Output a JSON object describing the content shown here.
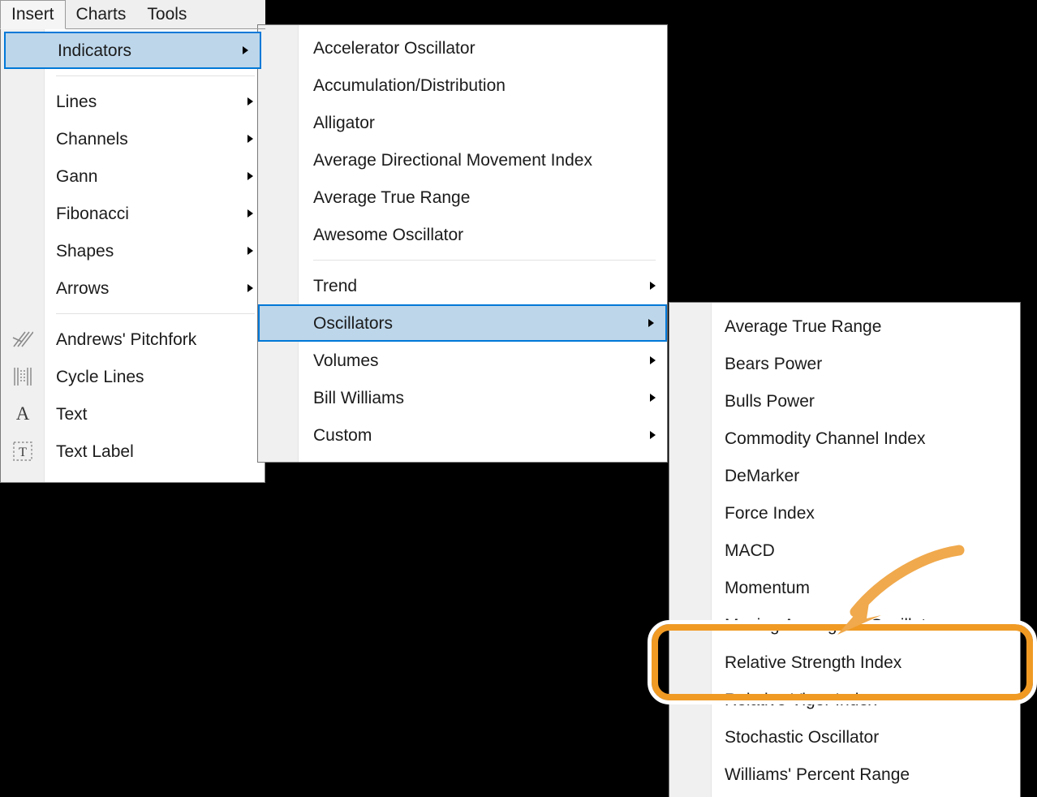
{
  "app": {
    "background_color": "#000000",
    "accent_selection_color": "#0078d7",
    "selection_fill_color": "#bdd6ea",
    "annotation_color": "#f09a24",
    "arrow_color": "#f0a94c"
  },
  "menubar": {
    "tabs": [
      {
        "label": "Insert",
        "active": true
      },
      {
        "label": "Charts",
        "active": false
      },
      {
        "label": "Tools",
        "active": false
      }
    ]
  },
  "menu_insert": {
    "name": "Insert menu",
    "groups": [
      {
        "items": [
          {
            "label": "Indicators",
            "has_submenu": true,
            "selected": true,
            "icon": null
          }
        ]
      },
      {
        "items": [
          {
            "label": "Lines",
            "has_submenu": true,
            "selected": false,
            "icon": null
          },
          {
            "label": "Channels",
            "has_submenu": true,
            "selected": false,
            "icon": null
          },
          {
            "label": "Gann",
            "has_submenu": true,
            "selected": false,
            "icon": null
          },
          {
            "label": "Fibonacci",
            "has_submenu": true,
            "selected": false,
            "icon": null
          },
          {
            "label": "Shapes",
            "has_submenu": true,
            "selected": false,
            "icon": null
          },
          {
            "label": "Arrows",
            "has_submenu": true,
            "selected": false,
            "icon": null
          }
        ]
      },
      {
        "items": [
          {
            "label": "Andrews' Pitchfork",
            "has_submenu": false,
            "selected": false,
            "icon": "pitchfork-icon"
          },
          {
            "label": "Cycle Lines",
            "has_submenu": false,
            "selected": false,
            "icon": "cycle-lines-icon"
          },
          {
            "label": "Text",
            "has_submenu": false,
            "selected": false,
            "icon": "text-a-icon"
          },
          {
            "label": "Text Label",
            "has_submenu": false,
            "selected": false,
            "icon": "text-label-icon"
          }
        ]
      }
    ]
  },
  "menu_indicators": {
    "name": "Indicators submenu",
    "groups": [
      {
        "items": [
          {
            "label": "Accelerator Oscillator",
            "has_submenu": false,
            "selected": false
          },
          {
            "label": "Accumulation/Distribution",
            "has_submenu": false,
            "selected": false
          },
          {
            "label": "Alligator",
            "has_submenu": false,
            "selected": false
          },
          {
            "label": "Average Directional Movement Index",
            "has_submenu": false,
            "selected": false
          },
          {
            "label": "Average True Range",
            "has_submenu": false,
            "selected": false
          },
          {
            "label": "Awesome Oscillator",
            "has_submenu": false,
            "selected": false
          }
        ]
      },
      {
        "items": [
          {
            "label": "Trend",
            "has_submenu": true,
            "selected": false
          },
          {
            "label": "Oscillators",
            "has_submenu": true,
            "selected": true
          },
          {
            "label": "Volumes",
            "has_submenu": true,
            "selected": false
          },
          {
            "label": "Bill Williams",
            "has_submenu": true,
            "selected": false
          },
          {
            "label": "Custom",
            "has_submenu": true,
            "selected": false
          }
        ]
      }
    ]
  },
  "menu_oscillators": {
    "name": "Oscillators submenu",
    "items": [
      {
        "label": "Average True Range",
        "highlighted": false
      },
      {
        "label": "Bears Power",
        "highlighted": false
      },
      {
        "label": "Bulls Power",
        "highlighted": false
      },
      {
        "label": "Commodity Channel Index",
        "highlighted": false
      },
      {
        "label": "DeMarker",
        "highlighted": false
      },
      {
        "label": "Force Index",
        "highlighted": false
      },
      {
        "label": "MACD",
        "highlighted": false
      },
      {
        "label": "Momentum",
        "highlighted": false
      },
      {
        "label": "Moving Average of Oscillator",
        "highlighted": false
      },
      {
        "label": "Relative Strength Index",
        "highlighted": true
      },
      {
        "label": "Relative Vigor Index",
        "highlighted": false
      },
      {
        "label": "Stochastic Oscillator",
        "highlighted": false
      },
      {
        "label": "Williams' Percent Range",
        "highlighted": false
      }
    ]
  },
  "annotations": {
    "highlight_target": "Relative Strength Index",
    "arrow": "curved-arrow-pointing-down-left"
  }
}
